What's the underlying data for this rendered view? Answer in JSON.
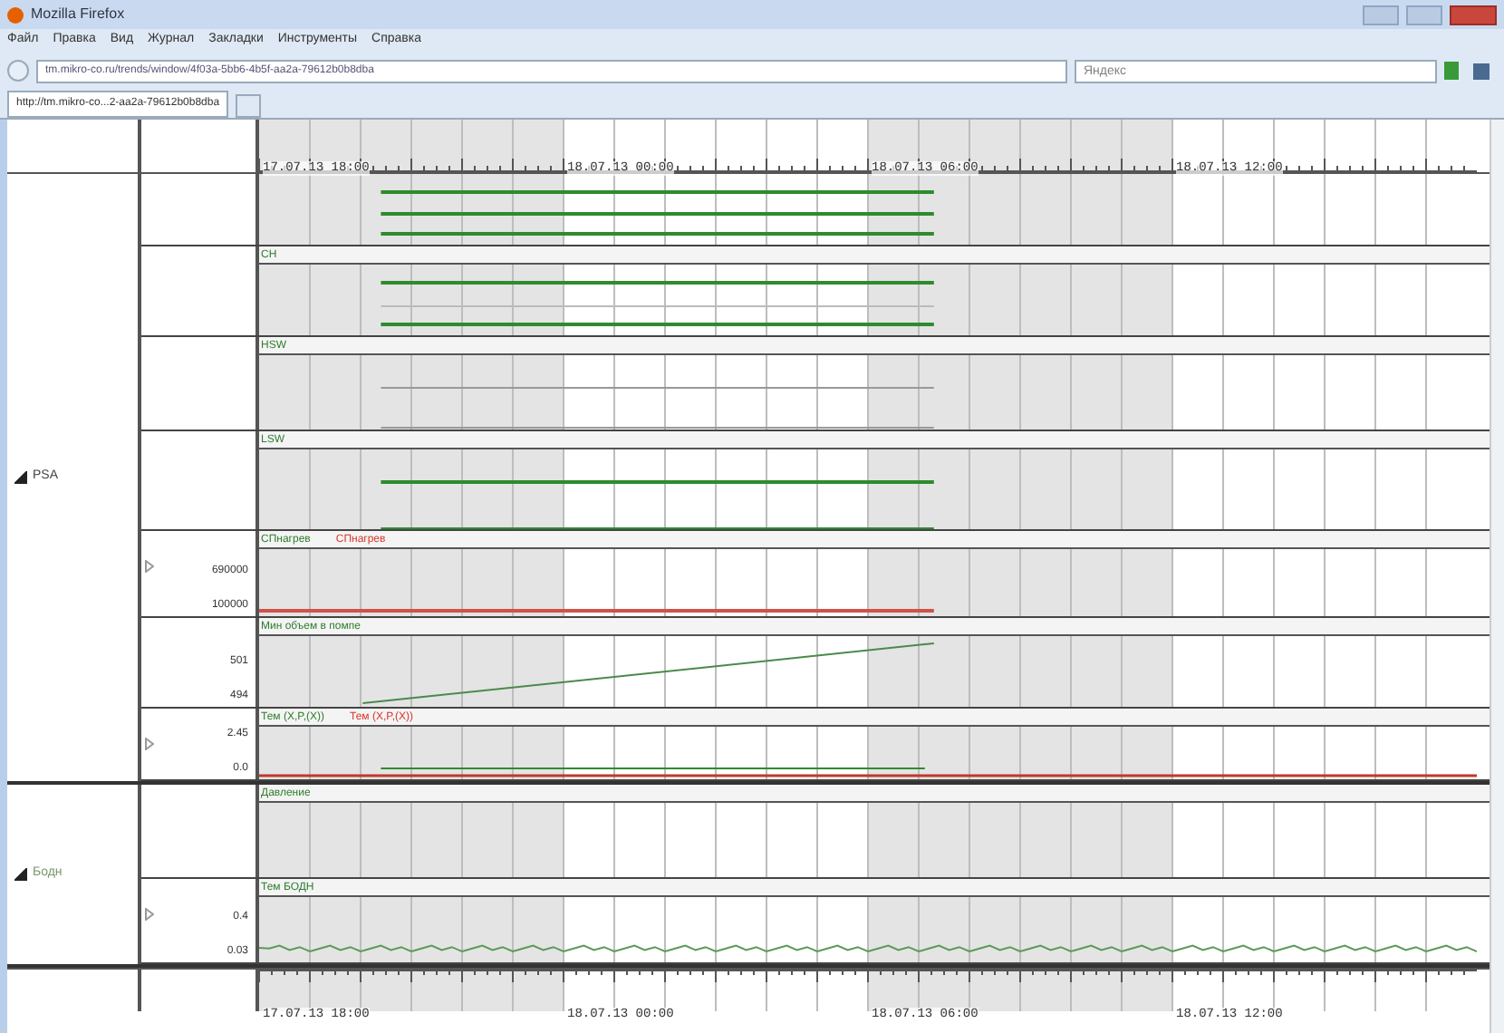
{
  "window": {
    "title": "Mozilla Firefox"
  },
  "menu": [
    "Файл",
    "Правка",
    "Вид",
    "Журнал",
    "Закладки",
    "Инструменты",
    "Справка"
  ],
  "address_bar": {
    "value": "tm.mikro-co.ru/trends/window/4f03a-5bb6-4b5f-aa2a-79612b0b8dba"
  },
  "search": {
    "placeholder": "Яндекс"
  },
  "tabs": [
    {
      "label": "http://tm.mikro-co...2-aa2a-79612b0b8dba",
      "selected": true
    }
  ],
  "timeline_top": [
    "17.07.13 18:00",
    "18.07.13 00:00",
    "18.07.13 06:00",
    "18.07.13 12:00"
  ],
  "timeline_bottom": [
    "17.07.13 18:00",
    "18.07.13 00:00",
    "18.07.13 06:00",
    "18.07.13 12:00"
  ],
  "groups": [
    {
      "label": "PSA",
      "expanded": true,
      "panels": [
        {
          "kind": "triple"
        },
        {
          "kind": "quad",
          "title": "CH"
        },
        {
          "kind": "gray",
          "title": "HSW"
        },
        {
          "kind": "pair",
          "title": "LSW"
        },
        {
          "kind": "flat",
          "title": "СПнагрев",
          "title_2": "СПнагрев",
          "axis": [
            "690000",
            "100000"
          ]
        },
        {
          "kind": "ramp",
          "title": "Мин объем в помпе",
          "axis": [
            "501",
            "494"
          ]
        },
        {
          "kind": "dots",
          "title": "Тем (X,P,(X))",
          "title_2": "Тем (X,P,(X))",
          "axis": [
            "2.45",
            "0.0"
          ]
        }
      ]
    },
    {
      "label": "Бодн",
      "expanded": true,
      "panels": [
        {
          "kind": "empty",
          "title": "Давление"
        },
        {
          "kind": "noise",
          "title": "Тем БОДН",
          "axis": [
            "0.4",
            "0.03"
          ]
        }
      ]
    }
  ]
}
